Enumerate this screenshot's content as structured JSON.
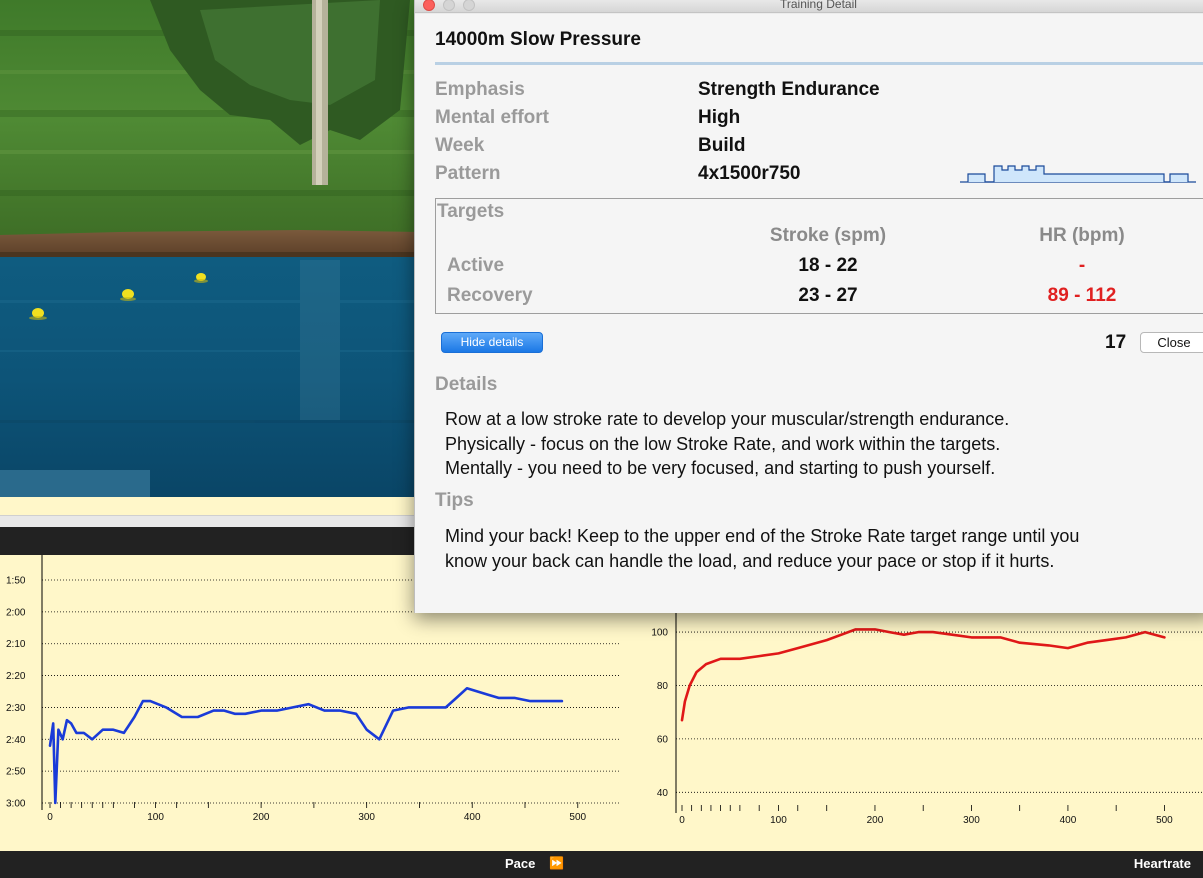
{
  "dialog": {
    "window_title": "Training Detail",
    "workout_title": "14000m Slow Pressure",
    "rows": [
      {
        "label": "Emphasis",
        "value": "Strength Endurance"
      },
      {
        "label": "Mental effort",
        "value": "High"
      },
      {
        "label": "Week",
        "value": "Build"
      },
      {
        "label": "Pattern",
        "value": "4x1500r750"
      }
    ],
    "targets": {
      "heading": "Targets",
      "columns": [
        "Stroke (spm)",
        "HR (bpm)"
      ],
      "active": {
        "label": "Active",
        "stroke": "18 - 22",
        "hr": "-"
      },
      "recovery": {
        "label": "Recovery",
        "stroke": "23 - 27",
        "hr": "89 - 112"
      }
    },
    "hide_details_label": "Hide details",
    "count": "17",
    "close_label": "Close",
    "details": {
      "heading": "Details",
      "lines": [
        "Row at a low stroke rate to develop your muscular/strength endurance.",
        "Physically - focus on the low Stroke Rate, and work within the targets.",
        "Mentally - you need to be very focused, and starting to push yourself."
      ]
    },
    "tips": {
      "heading": "Tips",
      "lines": [
        "Mind your back!  Keep to the upper end of the Stroke Rate target range until you",
        "know your back can handle the load, and reduce your pace or stop if it hurts."
      ]
    }
  },
  "colors": {
    "accent_blue": "#1b78e6",
    "hr_target_red": "#e02020",
    "pace_line": "#1a3bd8",
    "hr_line": "#e01818",
    "chart_bg": "#fff7c9"
  },
  "bottom_bar": {
    "pace_label": "Pace",
    "forward_icon": "fast-forward-icon",
    "heartrate_label": "Heartrate"
  },
  "chart_data": [
    {
      "type": "line",
      "name_hint": "pace",
      "y_ticks": [
        "1:50",
        "2:00",
        "2:10",
        "2:20",
        "2:30",
        "2:40",
        "2:50",
        "3:00"
      ],
      "x_ticks": [
        "0",
        "100",
        "200",
        "300",
        "400",
        "500"
      ],
      "xlim": [
        0,
        540
      ],
      "ylim_seconds": [
        110,
        180
      ],
      "y_inverted": true,
      "grid": "horizontal-dotted",
      "x": [
        0,
        3,
        5,
        8,
        12,
        16,
        20,
        25,
        32,
        40,
        50,
        60,
        70,
        80,
        88,
        95,
        110,
        125,
        140,
        155,
        165,
        175,
        185,
        200,
        215,
        230,
        245,
        260,
        275,
        290,
        300,
        312,
        325,
        340,
        355,
        365,
        375,
        385,
        395,
        405,
        415,
        425,
        440,
        455,
        470,
        485
      ],
      "y_seconds": [
        162,
        155,
        180,
        157,
        160,
        154,
        155,
        158,
        158,
        160,
        157,
        157,
        158,
        153,
        148,
        148,
        150,
        153,
        153,
        151,
        151,
        152,
        152,
        151,
        151,
        150,
        149,
        151,
        151,
        152,
        157,
        160,
        151,
        150,
        150,
        150,
        150,
        147,
        144,
        145,
        146,
        147,
        147,
        148,
        148,
        148
      ]
    },
    {
      "type": "line",
      "name_hint": "heartrate",
      "y_ticks": [
        "40",
        "60",
        "80",
        "100"
      ],
      "x_ticks": [
        "0",
        "100",
        "200",
        "300",
        "400",
        "500"
      ],
      "xlim": [
        0,
        540
      ],
      "ylim": [
        30,
        115
      ],
      "grid": "horizontal-dotted",
      "x": [
        0,
        3,
        8,
        15,
        25,
        40,
        60,
        80,
        100,
        120,
        150,
        180,
        200,
        215,
        230,
        245,
        260,
        280,
        300,
        330,
        350,
        380,
        400,
        420,
        440,
        460,
        480,
        500
      ],
      "y": [
        67,
        74,
        80,
        85,
        88,
        90,
        90,
        91,
        92,
        94,
        97,
        101,
        101,
        100,
        99,
        100,
        100,
        99,
        98,
        98,
        96,
        95,
        94,
        96,
        97,
        98,
        100,
        98
      ]
    }
  ]
}
